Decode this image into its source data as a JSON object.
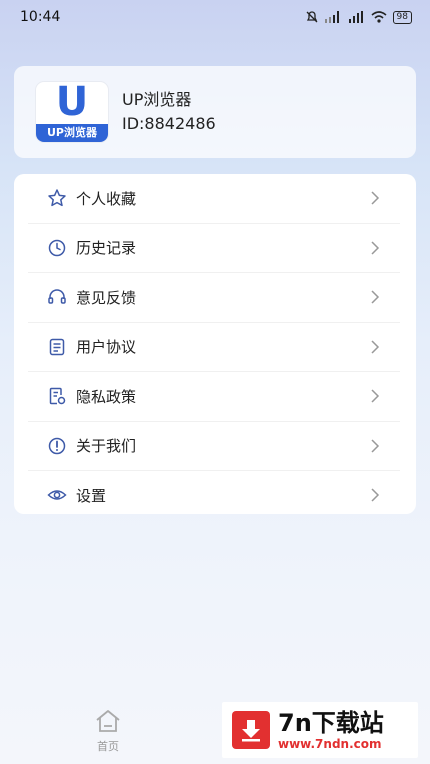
{
  "status_bar": {
    "time": "10:44",
    "network": "...|",
    "battery": "98"
  },
  "profile": {
    "logo_letter": "U",
    "logo_caption": "UP浏览器",
    "name": "UP浏览器",
    "id_text": "ID:8842486"
  },
  "menu": [
    {
      "label": "个人收藏",
      "icon": "star-icon"
    },
    {
      "label": "历史记录",
      "icon": "clock-icon"
    },
    {
      "label": "意见反馈",
      "icon": "headset-icon"
    },
    {
      "label": "用户协议",
      "icon": "document-icon"
    },
    {
      "label": "隐私政策",
      "icon": "privacy-doc-icon"
    },
    {
      "label": "关于我们",
      "icon": "info-icon"
    },
    {
      "label": "设置",
      "icon": "eye-settings-icon"
    }
  ],
  "bottom_nav": {
    "home_label": "首页"
  },
  "watermark": {
    "title": "7n下载站",
    "url": "www.7ndn.com"
  },
  "colors": {
    "accent": "#2f64d6",
    "icon": "#3e5aa8",
    "watermark_red": "#e23030"
  }
}
